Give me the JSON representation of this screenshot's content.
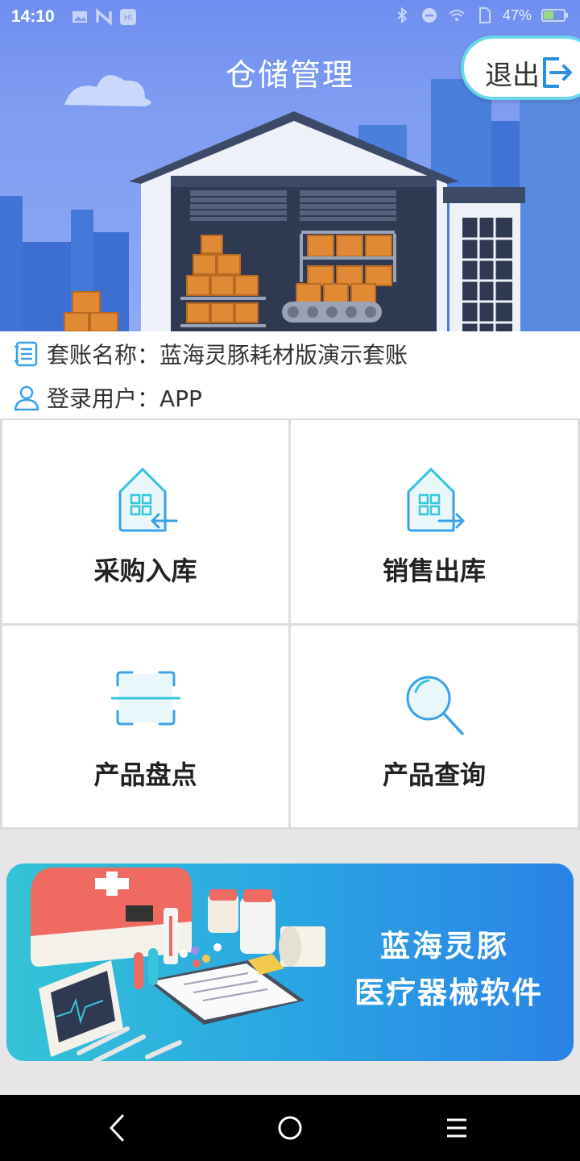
{
  "status_bar": {
    "time": "14:10",
    "battery_percent": "47%",
    "icons_left": [
      "gallery-icon",
      "n-icon",
      "hi-icon"
    ],
    "icons_right": [
      "bluetooth-icon",
      "dnd-icon",
      "wifi-icon",
      "sim-icon",
      "battery-icon"
    ]
  },
  "header": {
    "title": "仓储管理",
    "logout_label": "退出"
  },
  "info": {
    "account_label": "套账名称：蓝海灵豚耗材版演示套账",
    "user_label": "登录用户：APP"
  },
  "menu": {
    "items": [
      {
        "label": "采购入库",
        "icon": "warehouse-in-icon"
      },
      {
        "label": "销售出库",
        "icon": "warehouse-out-icon"
      },
      {
        "label": "产品盘点",
        "icon": "scan-icon"
      },
      {
        "label": "产品查询",
        "icon": "search-icon"
      }
    ]
  },
  "banner": {
    "line1": "蓝海灵豚",
    "line2": "医疗器械软件"
  },
  "colors": {
    "accent": "#3aa0e8",
    "hero": "#6f8ef0",
    "banner_start": "#34c3d6",
    "banner_end": "#2a82e6"
  }
}
